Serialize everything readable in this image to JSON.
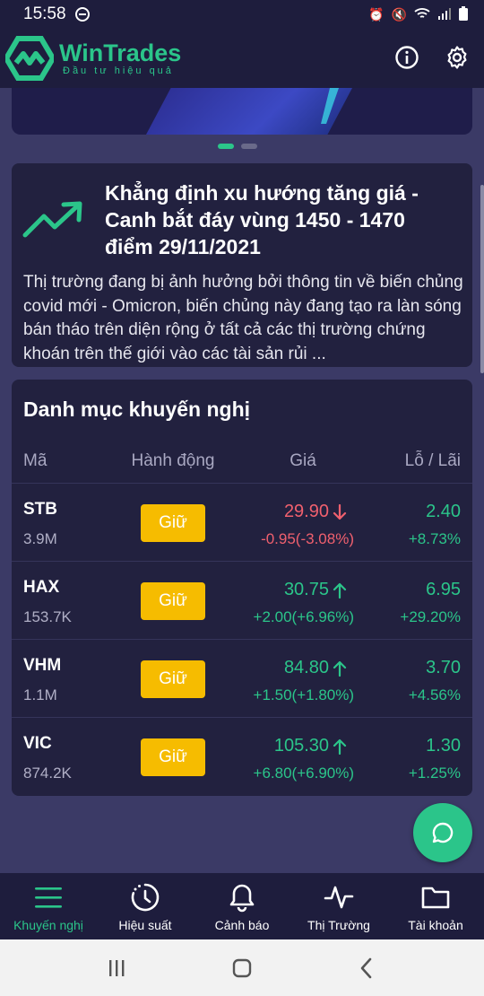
{
  "status_bar": {
    "time": "15:58"
  },
  "header": {
    "brand": "WinTrades",
    "tagline": "Đầu tư hiệu quả"
  },
  "news": {
    "title": "Khẳng định xu hướng tăng giá - Canh bắt đáy vùng 1450 - 1470 điểm 29/11/2021",
    "body": "Thị trường đang bị ảnh hưởng bởi thông tin về biến chủng covid mới - Omicron, biến chủng này đang tạo ra làn sóng bán tháo trên diện rộng ở tất cả các thị trường chứng khoán trên thế giới vào các tài sản rủi ..."
  },
  "portfolio": {
    "title": "Danh mục khuyến nghị",
    "headers": {
      "code": "Mã",
      "action": "Hành động",
      "price": "Giá",
      "pl": "Lỗ / Lãi"
    },
    "rows": [
      {
        "code": "STB",
        "volume": "3.9M",
        "action": "Giữ",
        "price": "29.90",
        "change": "-0.95(-3.08%)",
        "pl": "2.40",
        "pl_pct": "+8.73%",
        "direction": "down"
      },
      {
        "code": "HAX",
        "volume": "153.7K",
        "action": "Giữ",
        "price": "30.75",
        "change": "+2.00(+6.96%)",
        "pl": "6.95",
        "pl_pct": "+29.20%",
        "direction": "up"
      },
      {
        "code": "VHM",
        "volume": "1.1M",
        "action": "Giữ",
        "price": "84.80",
        "change": "+1.50(+1.80%)",
        "pl": "3.70",
        "pl_pct": "+4.56%",
        "direction": "up"
      },
      {
        "code": "VIC",
        "volume": "874.2K",
        "action": "Giữ",
        "price": "105.30",
        "change": "+6.80(+6.90%)",
        "pl": "1.30",
        "pl_pct": "+1.25%",
        "direction": "up"
      }
    ]
  },
  "bottom_nav": [
    {
      "label": "Khuyến nghị",
      "icon": "menu-icon",
      "active": true
    },
    {
      "label": "Hiệu suất",
      "icon": "performance-icon",
      "active": false
    },
    {
      "label": "Cảnh báo",
      "icon": "bell-icon",
      "active": false
    },
    {
      "label": "Thị Trường",
      "icon": "pulse-icon",
      "active": false
    },
    {
      "label": "Tài khoản",
      "icon": "folder-icon",
      "active": false
    }
  ],
  "colors": {
    "accent": "#2bc58a",
    "down": "#f0606e",
    "action_button": "#f6bc00",
    "background": "#3b3a66",
    "card": "#22213f"
  }
}
